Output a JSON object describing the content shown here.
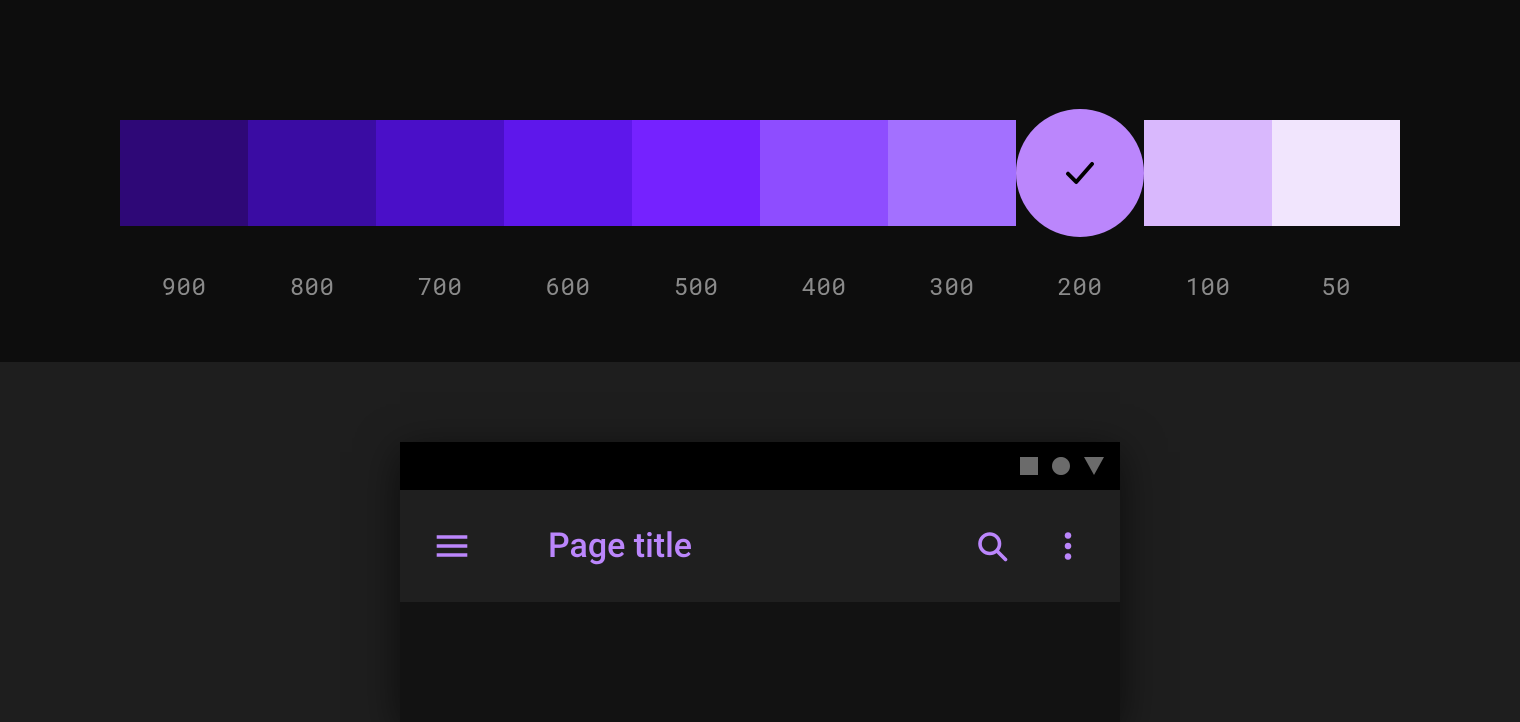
{
  "palette": {
    "selected_key": "200",
    "swatches": [
      {
        "key": "900",
        "hex": "#2E0877"
      },
      {
        "key": "800",
        "hex": "#3A0CA3"
      },
      {
        "key": "700",
        "hex": "#4A0FC8"
      },
      {
        "key": "600",
        "hex": "#5E17EB"
      },
      {
        "key": "500",
        "hex": "#7522FF"
      },
      {
        "key": "400",
        "hex": "#8E4DFF"
      },
      {
        "key": "300",
        "hex": "#A370FF"
      },
      {
        "key": "200",
        "hex": "#BB86FC"
      },
      {
        "key": "100",
        "hex": "#D9B8FD"
      },
      {
        "key": "50",
        "hex": "#F1E5FD"
      }
    ]
  },
  "preview": {
    "app_bar": {
      "title": "Page title",
      "accent": "#BB86FC"
    },
    "icons": {
      "menu": "menu-icon",
      "search": "search-icon",
      "more": "more-vert-icon"
    },
    "status_shapes": [
      "square",
      "circle",
      "triangle-down"
    ]
  }
}
